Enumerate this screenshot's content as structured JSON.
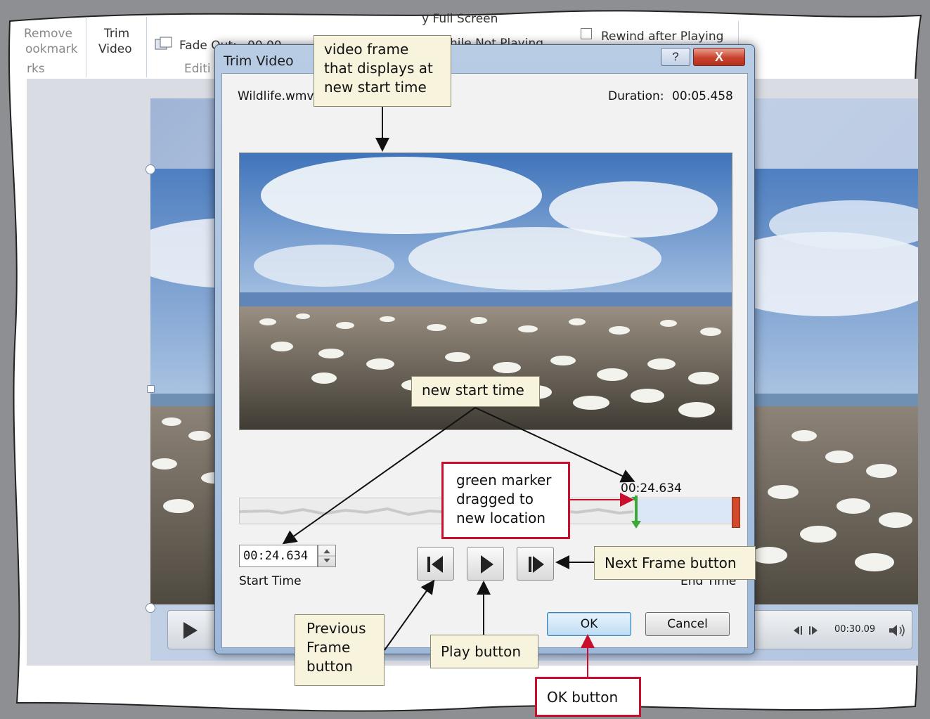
{
  "ribbon": {
    "remove_bookmark_line1": "Remove",
    "remove_bookmark_line2": "ookmark",
    "bookmarks_group": "rks",
    "trim_video_line1": "Trim",
    "trim_video_line2": "Video",
    "fade_out": "Fade Out:",
    "fade_out_value": "00.00",
    "editing_group": "Editi",
    "full_screen": "y Full Screen",
    "hide_not_playing": "hile Not Playing",
    "rewind_after_playing": "Rewind after Playing"
  },
  "player": {
    "time": "00:30.09"
  },
  "dialog": {
    "title": "Trim Video",
    "help_label": "?",
    "close_label": "X",
    "filename": "Wildlife.wmv",
    "duration_label": "Duration:",
    "duration_value": "00:05.458",
    "marker_time": "00:24.634",
    "start_time_value": "00:24.634",
    "start_time_label": "Start Time",
    "end_time_label": "End Time",
    "ok_label": "OK",
    "cancel_label": "Cancel"
  },
  "callouts": {
    "video_frame": "video frame\nthat displays at\nnew start time",
    "new_start_time": "new start time",
    "green_marker": "green marker\ndragged to\nnew location",
    "next_frame": "Next Frame button",
    "previous_frame": "Previous\nFrame\nbutton",
    "play": "Play button",
    "ok": "OK button"
  },
  "colors": {
    "callout_red": "#c8102e",
    "callout_fill": "#f7f3dc",
    "green_marker": "#3da83a",
    "red_marker": "#d24a2c"
  },
  "icons": [
    "previous-frame-icon",
    "play-icon",
    "next-frame-icon",
    "volume-icon",
    "help-icon",
    "close-icon",
    "spinner-arrows-icon"
  ]
}
